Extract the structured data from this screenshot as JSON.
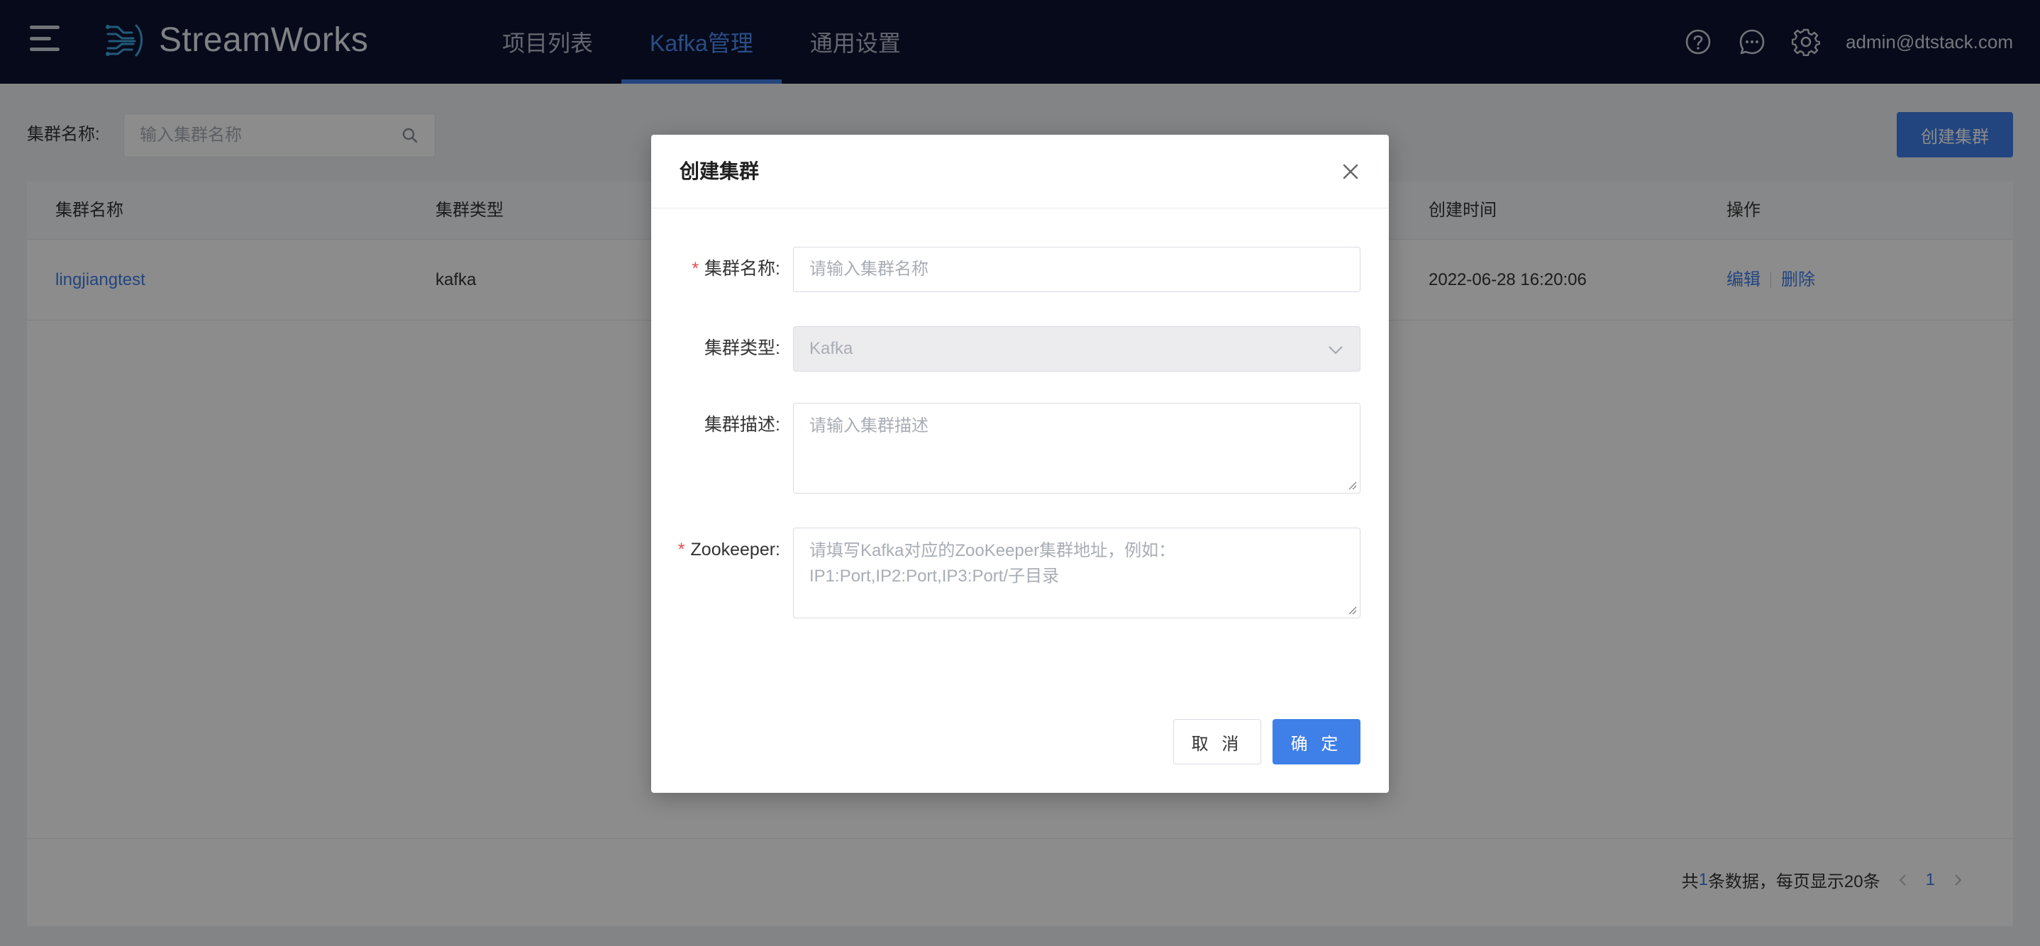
{
  "app": {
    "name": "StreamWorks",
    "icons": {
      "menu": "hamburger-menu-icon",
      "logo": "streamworks-logo-icon"
    }
  },
  "nav": {
    "items": [
      {
        "label": "项目列表",
        "active": false
      },
      {
        "label": "Kafka管理",
        "active": true
      },
      {
        "label": "通用设置",
        "active": false
      }
    ]
  },
  "header_right": {
    "icons": [
      "help-circle-icon",
      "message-icon",
      "gear-icon"
    ],
    "user": "admin@dtstack.com"
  },
  "filter": {
    "label": "集群名称:",
    "search_placeholder": "输入集群名称",
    "create_button": "创建集群"
  },
  "table": {
    "columns": [
      "集群名称",
      "集群类型",
      "创建时间",
      "操作"
    ],
    "rows": [
      {
        "name": "lingjiangtest",
        "type": "kafka",
        "created": "2022-06-28 16:20:06",
        "actions": [
          "编辑",
          "删除"
        ]
      }
    ],
    "footer": {
      "prefix": "共",
      "count": "1",
      "suffix": "条数据，每页显示20条",
      "page": "1"
    }
  },
  "modal": {
    "title": "创建集群",
    "fields": [
      {
        "label": "集群名称:",
        "required": true,
        "placeholder": "请输入集群名称"
      },
      {
        "label": "集群类型:",
        "required": false,
        "value": "Kafka",
        "disabled": true
      },
      {
        "label": "集群描述:",
        "required": false,
        "placeholder": "请输入集群描述"
      },
      {
        "label": "Zookeeper:",
        "required": true,
        "placeholder": "请填写Kafka对应的ZooKeeper集群地址，例如：\nIP1:Port,IP2:Port,IP3:Port/子目录"
      }
    ],
    "cancel": "取 消",
    "ok": "确 定"
  },
  "colors": {
    "topbar": "#0c1330",
    "primary": "#3f7fe8",
    "required": "#e84a4a"
  }
}
